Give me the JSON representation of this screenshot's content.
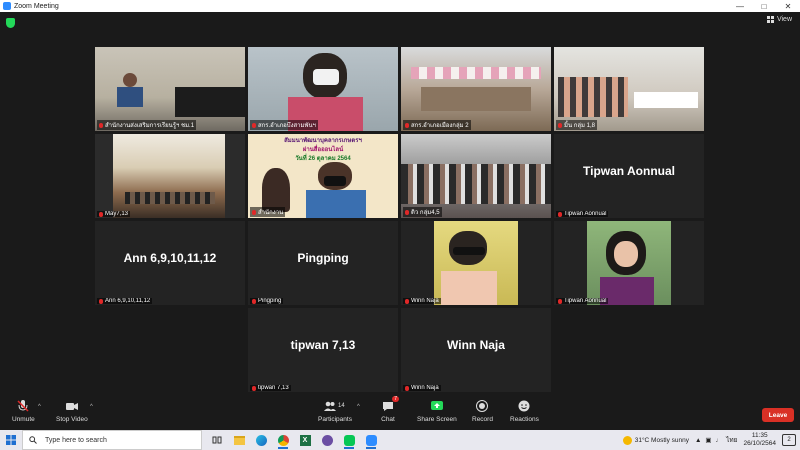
{
  "window": {
    "title": "Zoom Meeting",
    "view_label": "View"
  },
  "tiles": [
    {
      "name": "สำนักงานส่งเสริมการเรียนรู้ฯ ชม.1",
      "big": ""
    },
    {
      "name": "สกร.อำเภอบึงสามพันฯ",
      "big": ""
    },
    {
      "name": "สกร.อำเภอเมืองกลุ่ม 2",
      "big": ""
    },
    {
      "name": "มิ้น กลุ่ม 1,8",
      "big": ""
    },
    {
      "name": "May7,13",
      "big": ""
    },
    {
      "name": "สำนักงาน",
      "big": ""
    },
    {
      "name": "ดิว กลุ่ม4,5",
      "big": ""
    },
    {
      "name": "Tipwan Aonnual",
      "big": "Tipwan Aonnual"
    },
    {
      "name": "Ann 6,9,10,11,12",
      "big": "Ann 6,9,10,11,12"
    },
    {
      "name": "Pingping",
      "big": "Pingping"
    },
    {
      "name": "Winn Naja",
      "big": ""
    },
    {
      "name": "Tipwan Aonnual",
      "big": ""
    },
    {
      "name": "tipwan 7,13",
      "big": "tipwan 7,13"
    },
    {
      "name": "Winn Naja",
      "big": "Winn Naja"
    }
  ],
  "banner_text": {
    "line1": "สัมมนาพัฒนาบุคลากรเกษตรฯ",
    "line2": "ผ่านสื่อออนไลน์",
    "line3": "วันที่ 26 ตุลาคม 2564"
  },
  "toolbar": {
    "unmute": "Unmute",
    "stop_video": "Stop Video",
    "participants": "Participants",
    "participants_count": "14",
    "chat": "Chat",
    "chat_badge": "7",
    "share_screen": "Share Screen",
    "record": "Record",
    "reactions": "Reactions",
    "leave": "Leave"
  },
  "taskbar": {
    "search_placeholder": "Type here to search",
    "weather": "31°C  Mostly sunny",
    "lang": "ไทย",
    "time": "11:35",
    "date": "26/10/2564",
    "notif_count": "2"
  },
  "colors": {
    "zoom_blue": "#2d8cff",
    "leave_red": "#d93025",
    "share_green": "#23d959",
    "active_outline": "#c6f52b"
  }
}
